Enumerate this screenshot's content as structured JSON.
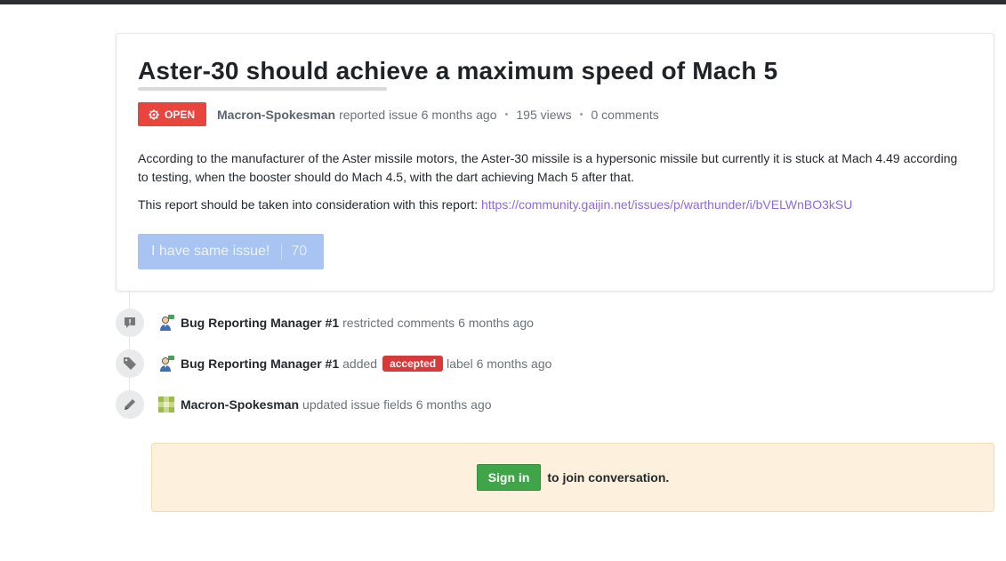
{
  "issue": {
    "title": "Aster-30 should achieve a maximum speed of Mach 5",
    "status": "OPEN",
    "author": "Macron-Spokesman",
    "action": "reported issue 6 months ago",
    "views": "195 views",
    "comments": "0 comments",
    "body_line1": "According to the manufacturer of the Aster missile motors, the Aster-30 missile is a hypersonic missile but currently it is stuck at Mach 4.49 according to testing, when the booster should do Mach 4.5, with the dart achieving Mach 5 after that.",
    "body_line2_prefix": "This report should be taken into consideration with this report: ",
    "body_link": "https://community.gaijin.net/issues/p/warthunder/i/bVELWnBO3kSU",
    "same_issue_label": "I have same issue!",
    "same_issue_count": "70"
  },
  "timeline": [
    {
      "icon": "comment-restricted-icon",
      "avatar": "manager-avatar",
      "user": "Bug Reporting Manager #1",
      "text": "restricted comments 6 months ago"
    },
    {
      "icon": "tag-icon",
      "avatar": "manager-avatar",
      "user": "Bug Reporting Manager #1",
      "text_before": "added",
      "label": "accepted",
      "text_after": "label 6 months ago"
    },
    {
      "icon": "pencil-icon",
      "avatar": "user-avatar",
      "user": "Macron-Spokesman",
      "text": "updated issue fields 6 months ago"
    }
  ],
  "signin": {
    "button": "Sign in",
    "text": "to join conversation."
  },
  "colors": {
    "open_badge": "#e8453c",
    "accepted_label": "#d73a3a",
    "link": "#8e6bdc",
    "signin_button": "#3fa548",
    "same_issue_button": "#a7c4f2"
  }
}
